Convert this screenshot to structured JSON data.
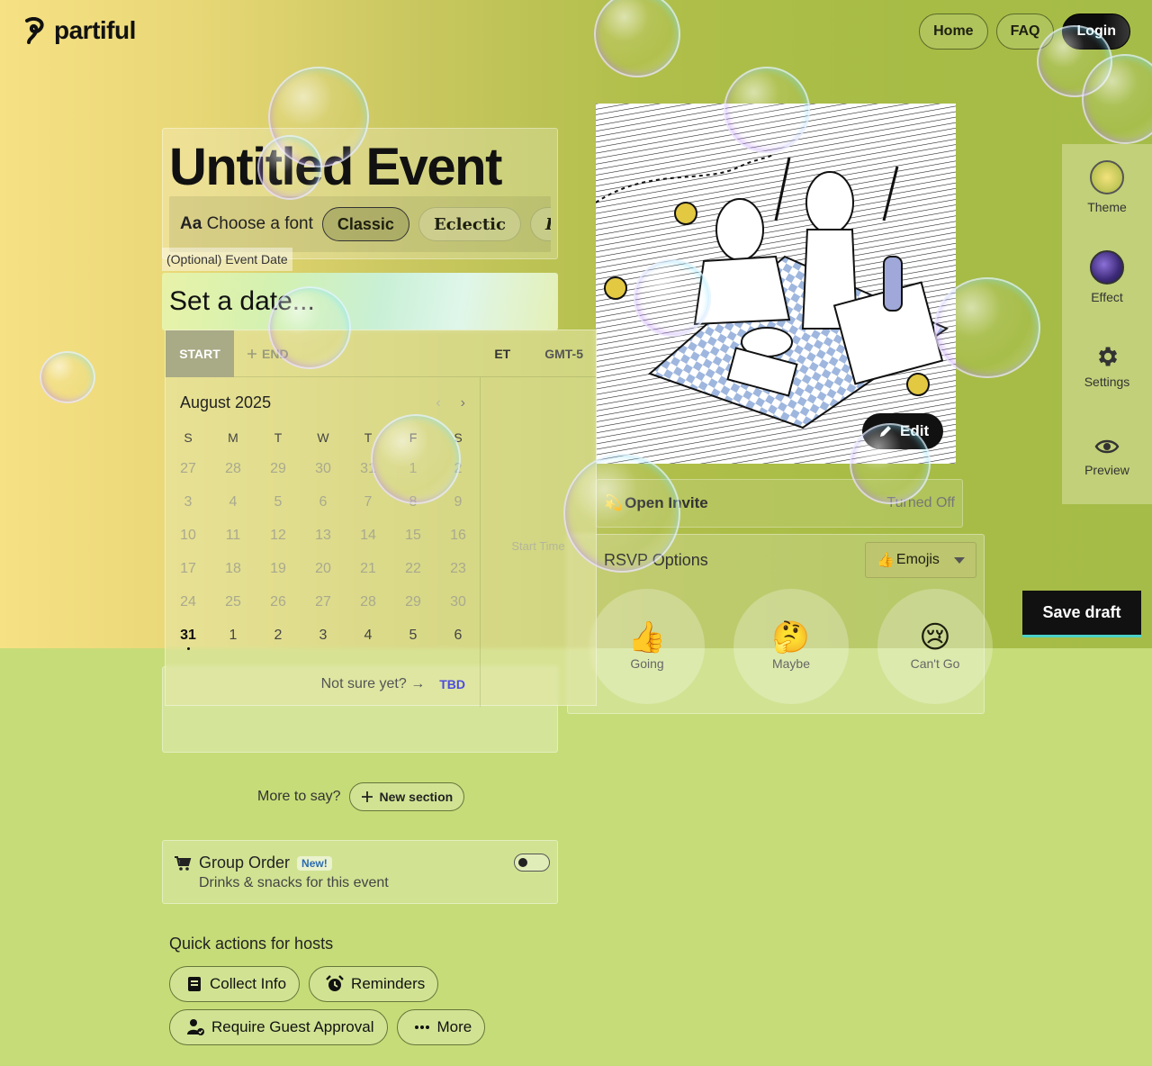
{
  "header": {
    "logo_text": "partiful",
    "nav": [
      {
        "label": "Home"
      },
      {
        "label": "FAQ"
      },
      {
        "label": "Login"
      }
    ]
  },
  "event": {
    "title": "Untitled Event",
    "font_picker": {
      "prefix_bold": "Aa",
      "prefix": "Choose a font",
      "options": [
        {
          "label": "Classic",
          "selected": true
        },
        {
          "label": "Eclectic",
          "selected": false
        },
        {
          "label": "Fancy",
          "selected": false
        }
      ]
    },
    "date_label": "(Optional) Event Date",
    "date_placeholder": "Set a date..."
  },
  "date_picker": {
    "tab_start": "START",
    "tab_end": "END",
    "timezone": "ET",
    "offset": "GMT-5",
    "month": "August 2025",
    "weekdays": [
      "S",
      "M",
      "T",
      "W",
      "T",
      "F",
      "S"
    ],
    "weeks": [
      [
        "27",
        "28",
        "29",
        "30",
        "31",
        "1",
        "2"
      ],
      [
        "3",
        "4",
        "5",
        "6",
        "7",
        "8",
        "9"
      ],
      [
        "10",
        "11",
        "12",
        "13",
        "14",
        "15",
        "16"
      ],
      [
        "17",
        "18",
        "19",
        "20",
        "21",
        "22",
        "23"
      ],
      [
        "24",
        "25",
        "26",
        "27",
        "28",
        "29",
        "30"
      ],
      [
        "31",
        "1",
        "2",
        "3",
        "4",
        "5",
        "6"
      ]
    ],
    "today": "31",
    "not_sure": "Not sure yet? →",
    "tbd": "TBD",
    "start_time_label": "Start Time"
  },
  "poster": {
    "edit_label": "Edit"
  },
  "open_invite": {
    "title": "Open Invite",
    "status": "Turned Off"
  },
  "rsvp": {
    "title": "RSVP Options",
    "style_select": "Emojis",
    "style_emoji": "👍",
    "options": [
      {
        "emoji": "👍",
        "label": "Going"
      },
      {
        "emoji": "🤔",
        "label": "Maybe"
      },
      {
        "emoji": "😢",
        "label": "Can't Go"
      }
    ]
  },
  "save_draft": "Save draft",
  "sidebar": {
    "items": [
      {
        "label": "Theme"
      },
      {
        "label": "Effect"
      },
      {
        "label": "Settings"
      },
      {
        "label": "Preview"
      }
    ]
  },
  "more": {
    "label": "More to say?",
    "button": "New section"
  },
  "group_order": {
    "title": "Group Order",
    "badge": "New!",
    "subtitle": "Drinks & snacks for this event"
  },
  "quick_actions": {
    "title": "Quick actions for hosts",
    "buttons": [
      {
        "label": "Collect Info",
        "icon": "clipboard-icon"
      },
      {
        "label": "Reminders",
        "icon": "alarm-icon"
      },
      {
        "label": "Require Guest Approval",
        "icon": "user-check-icon"
      },
      {
        "label": "More",
        "icon": "ellipsis-icon"
      }
    ]
  }
}
